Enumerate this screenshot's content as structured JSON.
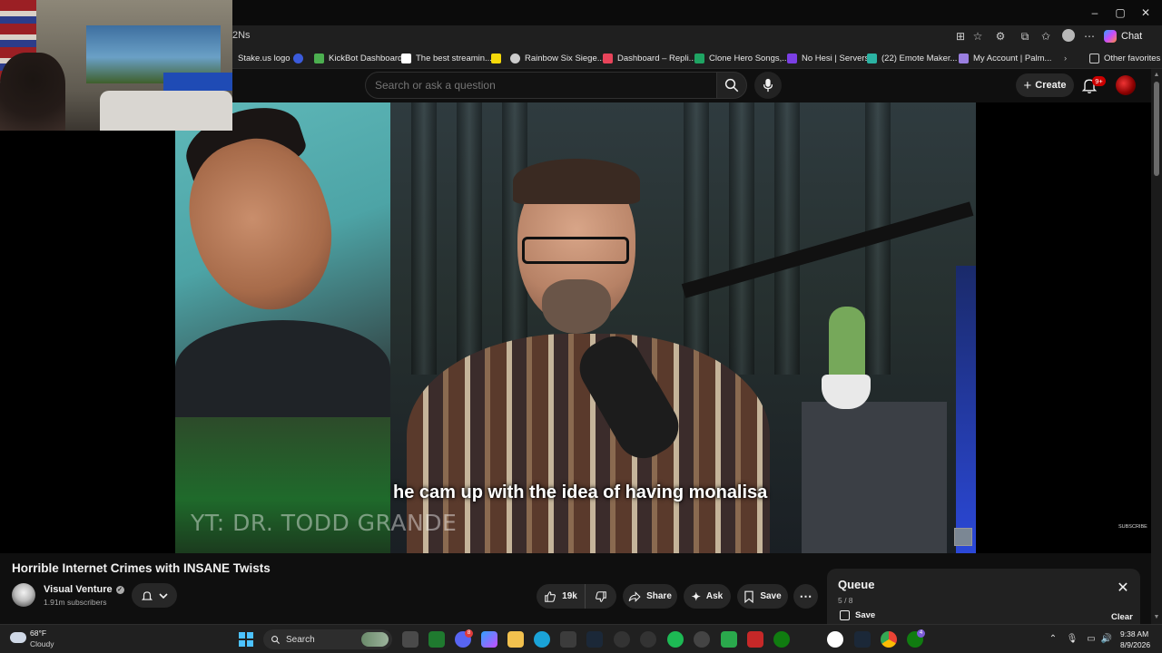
{
  "browser": {
    "url_fragment": "2Ns",
    "chat_label": "Chat",
    "window_controls": {
      "minimize": "–",
      "maximize": "▢",
      "close": "✕"
    },
    "bookmarks": [
      {
        "label": "Stake.us logo",
        "color": "#1a1a1a"
      },
      {
        "label": "",
        "color": "#3b5bdb"
      },
      {
        "label": "KickBot Dashboard",
        "color": "#4caf50"
      },
      {
        "label": "The best streamin...",
        "color": "#ffffff"
      },
      {
        "label": "",
        "color": "#f5d90a"
      },
      {
        "label": "Rainbow Six Siege...",
        "color": "#cccccc"
      },
      {
        "label": "Dashboard – Repli...",
        "color": "#e8445a"
      },
      {
        "label": "Clone Hero Songs,...",
        "color": "#1fa463"
      },
      {
        "label": "No Hesi | Servers",
        "color": "#7b3fe4"
      },
      {
        "label": "(22) Emote Maker...",
        "color": "#2bb3a3"
      },
      {
        "label": "My Account | Palm...",
        "color": "#9a7fe0"
      }
    ],
    "other_favorites": "Other favorites"
  },
  "youtube": {
    "search_placeholder": "Search or ask a question",
    "create_label": "Create",
    "notification_count": "9+"
  },
  "video": {
    "caption": "he cam up with the idea of having monalisa",
    "watermark": "YT: DR. TODD GRANDE",
    "subscribe_watermark": "SUBSCRIBE",
    "title": "Horrible Internet Crimes with INSANE Twists",
    "channel": {
      "name": "Visual Venture",
      "subscribers": "1.91m subscribers"
    },
    "actions": {
      "likes": "19k",
      "share": "Share",
      "ask": "Ask",
      "save": "Save"
    }
  },
  "queue": {
    "title": "Queue",
    "count": "5 / 8",
    "save_label": "Save",
    "clear_label": "Clear"
  },
  "taskbar": {
    "weather_temp": "68°F",
    "weather_desc": "Cloudy",
    "search_label": "Search",
    "time": "9:38 AM",
    "date": "8/9/2026",
    "badges": {
      "discord": "8",
      "xbox": "4"
    }
  }
}
